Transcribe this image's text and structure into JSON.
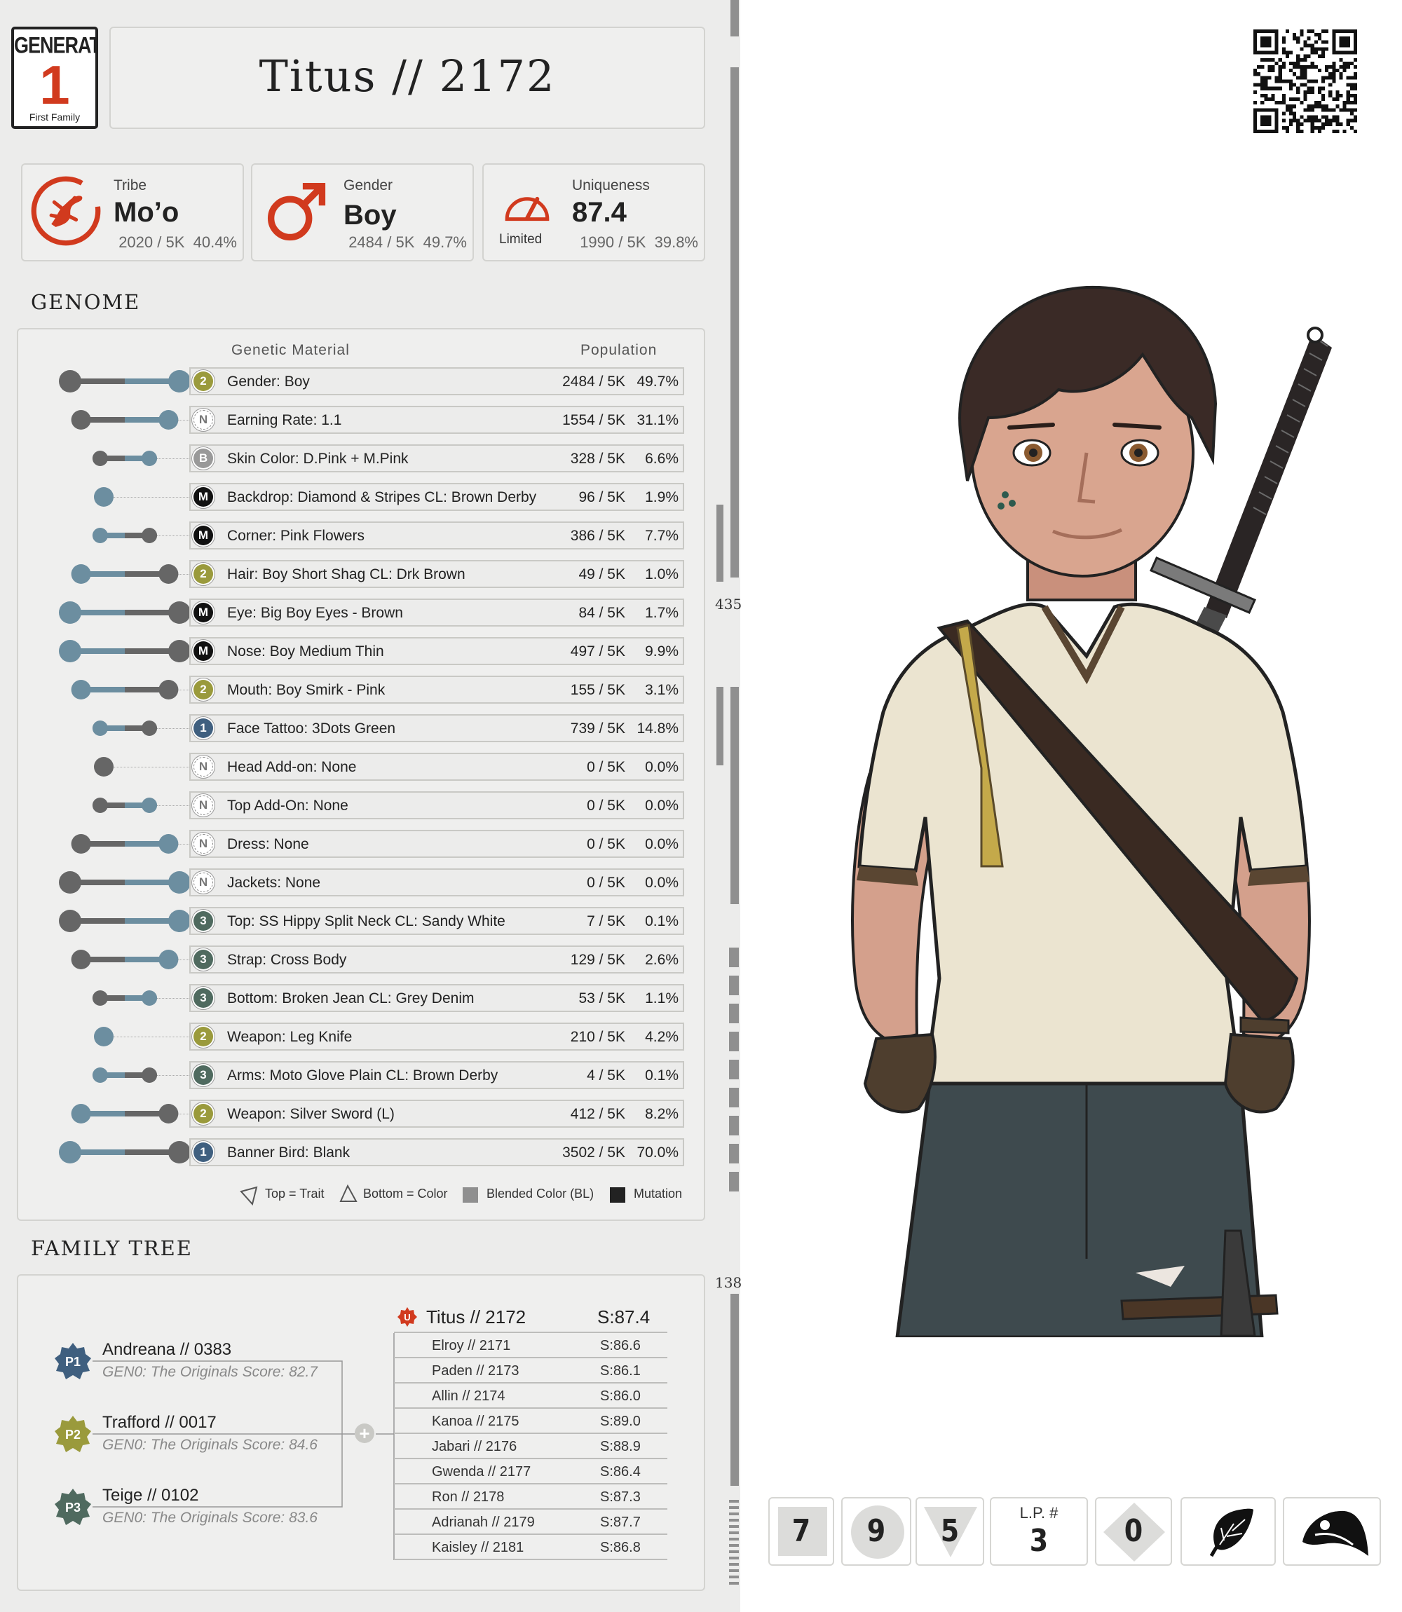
{
  "generation": {
    "word": "GENERATION",
    "number": "1",
    "subtitle": "First Family"
  },
  "title": "Titus // 2172",
  "stats": {
    "tribe": {
      "label": "Tribe",
      "value": "Mo’o",
      "count": "2020 / 5K",
      "pct": "40.4%",
      "icon": "lizard-icon"
    },
    "gender": {
      "label": "Gender",
      "value": "Boy",
      "count": "2484 / 5K",
      "pct": "49.7%",
      "icon": "male-symbol-icon"
    },
    "uniqueness": {
      "label": "Uniqueness",
      "value": "87.4",
      "tier": "Limited",
      "count": "1990 / 5K",
      "pct": "39.8%",
      "icon": "gauge-icon"
    }
  },
  "genome": {
    "title": "GENOME",
    "header_material": "Genetic Material",
    "header_population": "Population",
    "rows": [
      {
        "badge": "2",
        "badge_color": "#9a9a3c",
        "name": "Gender: Boy",
        "count": "2484 / 5K",
        "pct": "49.7%",
        "l": "#666666",
        "r": "#6c8ea0",
        "span": 1.0
      },
      {
        "badge": "N",
        "badge_color": "#ffffff",
        "name": "Earning Rate: 1.1",
        "count": "1554 / 5K",
        "pct": "31.1%",
        "l": "#666666",
        "r": "#6c8ea0",
        "span": 0.8
      },
      {
        "badge": "B",
        "badge_color": "#999999",
        "name": "Skin Color: D.Pink + M.Pink",
        "count": "328 / 5K",
        "pct": "6.6%",
        "l": "#666666",
        "r": "#6c8ea0",
        "span": 0.45
      },
      {
        "badge": "M",
        "badge_color": "#111111",
        "name": "Backdrop: Diamond & Stripes CL: Brown Derby",
        "count": "96 / 5K",
        "pct": "1.9%",
        "l": "#6c8ea0",
        "r": "#6c8ea0",
        "span": 0
      },
      {
        "badge": "M",
        "badge_color": "#111111",
        "name": "Corner: Pink Flowers",
        "count": "386 / 5K",
        "pct": "7.7%",
        "l": "#6c8ea0",
        "r": "#666666",
        "span": 0.45
      },
      {
        "badge": "2",
        "badge_color": "#9a9a3c",
        "name": "Hair: Boy Short Shag CL: Drk Brown",
        "count": "49 / 5K",
        "pct": "1.0%",
        "l": "#6c8ea0",
        "r": "#666666",
        "span": 0.8
      },
      {
        "badge": "M",
        "badge_color": "#111111",
        "name": "Eye: Big Boy Eyes - Brown",
        "count": "84 / 5K",
        "pct": "1.7%",
        "l": "#6c8ea0",
        "r": "#666666",
        "span": 1.0
      },
      {
        "badge": "M",
        "badge_color": "#111111",
        "name": "Nose: Boy Medium Thin",
        "count": "497 / 5K",
        "pct": "9.9%",
        "l": "#6c8ea0",
        "r": "#666666",
        "span": 1.0
      },
      {
        "badge": "2",
        "badge_color": "#9a9a3c",
        "name": "Mouth: Boy Smirk - Pink",
        "count": "155 / 5K",
        "pct": "3.1%",
        "l": "#6c8ea0",
        "r": "#666666",
        "span": 0.8
      },
      {
        "badge": "1",
        "badge_color": "#3f5f7f",
        "name": "Face Tattoo: 3Dots Green",
        "count": "739 / 5K",
        "pct": "14.8%",
        "l": "#6c8ea0",
        "r": "#666666",
        "span": 0.45
      },
      {
        "badge": "N",
        "badge_color": "#ffffff",
        "name": "Head Add-on:  None",
        "count": "0 / 5K",
        "pct": "0.0%",
        "l": "#666666",
        "r": "#666666",
        "span": 0
      },
      {
        "badge": "N",
        "badge_color": "#ffffff",
        "name": "Top Add-On:  None",
        "count": "0 / 5K",
        "pct": "0.0%",
        "l": "#666666",
        "r": "#6c8ea0",
        "span": 0.45
      },
      {
        "badge": "N",
        "badge_color": "#ffffff",
        "name": "Dress: None",
        "count": "0 / 5K",
        "pct": "0.0%",
        "l": "#666666",
        "r": "#6c8ea0",
        "span": 0.8
      },
      {
        "badge": "N",
        "badge_color": "#ffffff",
        "name": "Jackets: None",
        "count": "0 / 5K",
        "pct": "0.0%",
        "l": "#666666",
        "r": "#6c8ea0",
        "span": 1.0
      },
      {
        "badge": "3",
        "badge_color": "#4f6a5f",
        "name": "Top: SS Hippy Split Neck CL: Sandy White",
        "count": "7 / 5K",
        "pct": "0.1%",
        "l": "#666666",
        "r": "#6c8ea0",
        "span": 1.0
      },
      {
        "badge": "3",
        "badge_color": "#4f6a5f",
        "name": "Strap: Cross Body",
        "count": "129 / 5K",
        "pct": "2.6%",
        "l": "#666666",
        "r": "#6c8ea0",
        "span": 0.8
      },
      {
        "badge": "3",
        "badge_color": "#4f6a5f",
        "name": "Bottom: Broken Jean CL: Grey Denim",
        "count": "53 / 5K",
        "pct": "1.1%",
        "l": "#666666",
        "r": "#6c8ea0",
        "span": 0.45
      },
      {
        "badge": "2",
        "badge_color": "#9a9a3c",
        "name": "Weapon: Leg Knife",
        "count": "210 / 5K",
        "pct": "4.2%",
        "l": "#6c8ea0",
        "r": "#6c8ea0",
        "span": 0
      },
      {
        "badge": "3",
        "badge_color": "#4f6a5f",
        "name": "Arms: Moto Glove Plain CL: Brown Derby",
        "count": "4 / 5K",
        "pct": "0.1%",
        "l": "#6c8ea0",
        "r": "#666666",
        "span": 0.45
      },
      {
        "badge": "2",
        "badge_color": "#9a9a3c",
        "name": "Weapon: Silver Sword (L)",
        "count": "412 / 5K",
        "pct": "8.2%",
        "l": "#6c8ea0",
        "r": "#666666",
        "span": 0.8
      },
      {
        "badge": "1",
        "badge_color": "#3f5f7f",
        "name": "Banner Bird:  Blank",
        "count": "3502 / 5K",
        "pct": "70.0%",
        "l": "#6c8ea0",
        "r": "#666666",
        "span": 1.0
      }
    ],
    "legend": {
      "trait": "Top = Trait",
      "color": "Bottom = Color",
      "blended": "Blended Color (BL)",
      "mutation": "Mutation"
    }
  },
  "family": {
    "title": "FAMILY TREE",
    "parents": [
      {
        "badge": "P1",
        "color": "#3f5f7f",
        "name": "Andreana  //  0383",
        "score": "GEN0: The Originals Score: 82.7"
      },
      {
        "badge": "P2",
        "color": "#9a9a3c",
        "name": "Trafford  //  0017",
        "score": "GEN0: The Originals Score: 84.6"
      },
      {
        "badge": "P3",
        "color": "#4f6a5f",
        "name": "Teige  //  0102",
        "score": "GEN0: The Originals Score: 83.6"
      }
    ],
    "self": {
      "badge": "U",
      "name": "Titus // 2172",
      "score": "S:87.4"
    },
    "siblings": [
      {
        "name": "Elroy  //  2171",
        "score": "S:86.6"
      },
      {
        "name": "Paden  //  2173",
        "score": "S:86.1"
      },
      {
        "name": "Allin  //  2174",
        "score": "S:86.0"
      },
      {
        "name": "Kanoa  //  2175",
        "score": "S:89.0"
      },
      {
        "name": "Jabari  //  2176",
        "score": "S:88.9"
      },
      {
        "name": "Gwenda  //  2177",
        "score": "S:86.4"
      },
      {
        "name": "Ron  //  2178",
        "score": "S:87.3"
      },
      {
        "name": "Adrianah  //  2179",
        "score": "S:87.7"
      },
      {
        "name": "Kaisley  //  2181",
        "score": "S:86.8"
      }
    ]
  },
  "scale": {
    "upper": "435",
    "lower": "138"
  },
  "bottom_tiles": {
    "square": "7",
    "circle": "9",
    "triangle": "5",
    "lp_label": "L.P. #",
    "lp_value": "3",
    "diamond": "0",
    "leaf_icon": "leaf-icon",
    "bird_icon": "bird-head-icon"
  },
  "colors": {
    "accent_red": "#d13a1e",
    "bar_blue": "#6c8ea0",
    "bar_grey": "#666666",
    "panel_bg": "#ececeb"
  }
}
